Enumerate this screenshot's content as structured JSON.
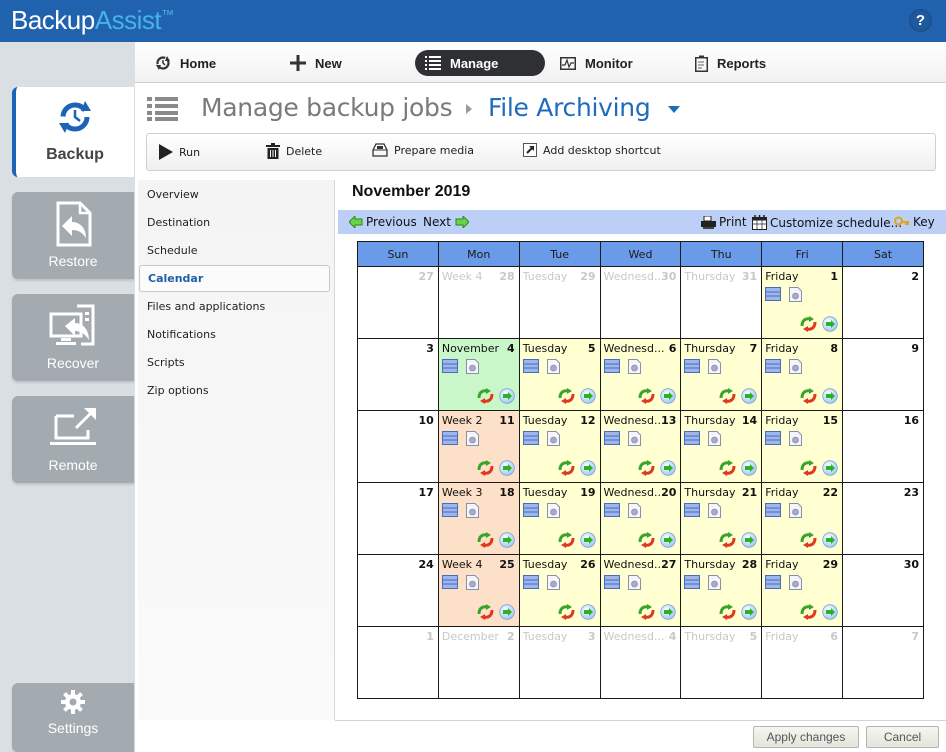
{
  "app": {
    "brand_part1": "Backup",
    "brand_part2": "Assist",
    "brand_tm": "™",
    "help_label": "?"
  },
  "left_rail": {
    "items": [
      {
        "label": "Backup",
        "icon": "backup-sync-icon",
        "active": true
      },
      {
        "label": "Restore",
        "icon": "restore-file-icon",
        "active": false
      },
      {
        "label": "Recover",
        "icon": "recover-computer-icon",
        "active": false
      },
      {
        "label": "Remote",
        "icon": "remote-laptop-icon",
        "active": false
      },
      {
        "label": "Settings",
        "icon": "gear-icon",
        "active": false
      }
    ]
  },
  "top_nav": {
    "items": [
      {
        "label": "Home",
        "icon": "home-refresh-icon"
      },
      {
        "label": "New",
        "icon": "plus-icon"
      },
      {
        "label": "Manage",
        "icon": "list-icon",
        "active": true
      },
      {
        "label": "Monitor",
        "icon": "monitor-pulse-icon"
      },
      {
        "label": "Reports",
        "icon": "clipboard-icon"
      }
    ]
  },
  "breadcrumb": {
    "parent": "Manage backup jobs",
    "current": "File Archiving"
  },
  "toolbar": {
    "run": "Run",
    "delete": "Delete",
    "prepare_media": "Prepare media",
    "add_shortcut": "Add desktop shortcut"
  },
  "job_nav": {
    "items": [
      "Overview",
      "Destination",
      "Schedule",
      "Calendar",
      "Files and applications",
      "Notifications",
      "Scripts",
      "Zip options"
    ],
    "active": "Calendar"
  },
  "calendar": {
    "title": "November 2019",
    "previous": "Previous",
    "next": "Next",
    "print": "Print",
    "customize": "Customize schedule...",
    "key": "Key",
    "weekdays": [
      "Sun",
      "Mon",
      "Tue",
      "Wed",
      "Thu",
      "Fri",
      "Sat"
    ],
    "colors": {
      "header": "#6a9be8",
      "job": "#ffffd2",
      "today": "#c9f7c9",
      "week_job": "#fde0c8",
      "bar": "#bbcff7"
    },
    "weeks": [
      [
        {
          "day": "27",
          "label": "",
          "type": "dim"
        },
        {
          "day": "28",
          "label": "Week 4",
          "type": "dim"
        },
        {
          "day": "29",
          "label": "Tuesday",
          "type": "dim"
        },
        {
          "day": "30",
          "label": "Wednesd...",
          "type": "dim"
        },
        {
          "day": "31",
          "label": "Thursday",
          "type": "dim"
        },
        {
          "day": "1",
          "label": "Friday",
          "type": "job"
        },
        {
          "day": "2",
          "label": "",
          "type": "empty"
        }
      ],
      [
        {
          "day": "3",
          "label": "",
          "type": "empty"
        },
        {
          "day": "4",
          "label": "November",
          "type": "today"
        },
        {
          "day": "5",
          "label": "Tuesday",
          "type": "job"
        },
        {
          "day": "6",
          "label": "Wednesd...",
          "type": "job"
        },
        {
          "day": "7",
          "label": "Thursday",
          "type": "job"
        },
        {
          "day": "8",
          "label": "Friday",
          "type": "job"
        },
        {
          "day": "9",
          "label": "",
          "type": "empty"
        }
      ],
      [
        {
          "day": "10",
          "label": "",
          "type": "empty"
        },
        {
          "day": "11",
          "label": "Week 2",
          "type": "week"
        },
        {
          "day": "12",
          "label": "Tuesday",
          "type": "job"
        },
        {
          "day": "13",
          "label": "Wednesd...",
          "type": "job"
        },
        {
          "day": "14",
          "label": "Thursday",
          "type": "job"
        },
        {
          "day": "15",
          "label": "Friday",
          "type": "job"
        },
        {
          "day": "16",
          "label": "",
          "type": "empty"
        }
      ],
      [
        {
          "day": "17",
          "label": "",
          "type": "empty"
        },
        {
          "day": "18",
          "label": "Week 3",
          "type": "week"
        },
        {
          "day": "19",
          "label": "Tuesday",
          "type": "job"
        },
        {
          "day": "20",
          "label": "Wednesd...",
          "type": "job"
        },
        {
          "day": "21",
          "label": "Thursday",
          "type": "job"
        },
        {
          "day": "22",
          "label": "Friday",
          "type": "job"
        },
        {
          "day": "23",
          "label": "",
          "type": "empty"
        }
      ],
      [
        {
          "day": "24",
          "label": "",
          "type": "empty"
        },
        {
          "day": "25",
          "label": "Week 4",
          "type": "week"
        },
        {
          "day": "26",
          "label": "Tuesday",
          "type": "job"
        },
        {
          "day": "27",
          "label": "Wednesd...",
          "type": "job"
        },
        {
          "day": "28",
          "label": "Thursday",
          "type": "job"
        },
        {
          "day": "29",
          "label": "Friday",
          "type": "job"
        },
        {
          "day": "30",
          "label": "",
          "type": "empty"
        }
      ],
      [
        {
          "day": "1",
          "label": "",
          "type": "dim"
        },
        {
          "day": "2",
          "label": "December",
          "type": "dim"
        },
        {
          "day": "3",
          "label": "Tuesday",
          "type": "dim"
        },
        {
          "day": "4",
          "label": "Wednesd...",
          "type": "dim"
        },
        {
          "day": "5",
          "label": "Thursday",
          "type": "dim"
        },
        {
          "day": "6",
          "label": "Friday",
          "type": "dim"
        },
        {
          "day": "7",
          "label": "",
          "type": "dim"
        }
      ]
    ]
  },
  "footer": {
    "apply": "Apply changes",
    "cancel": "Cancel"
  }
}
